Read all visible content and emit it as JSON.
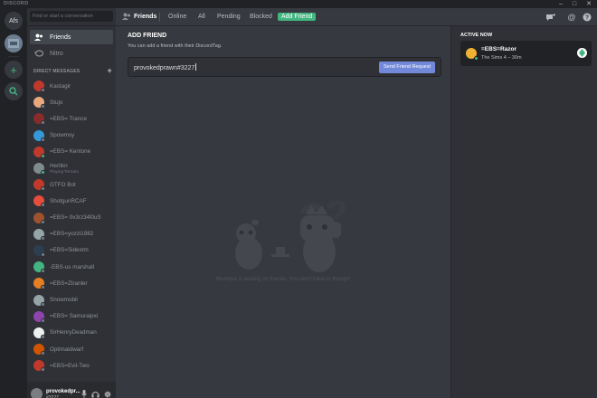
{
  "app": {
    "title": "DISCORD"
  },
  "guilds": [
    {
      "label": "Afs"
    }
  ],
  "search": {
    "placeholder": "Find or start a conversation"
  },
  "nav": {
    "friends_label": "Friends",
    "nitro_label": "Nitro"
  },
  "dm_section": {
    "header": "DIRECT MESSAGES",
    "add_symbol": "+"
  },
  "direct_messages": [
    {
      "name": "Kastagir",
      "color": "#c0392b",
      "online": false
    },
    {
      "name": "Stujo",
      "color": "#e8a87c",
      "online": false
    },
    {
      "name": "=EBS= Trance",
      "color": "#8a2b2b",
      "online": false
    },
    {
      "name": "Spowmsy",
      "color": "#3498db",
      "online": false
    },
    {
      "name": "=EBS= Kentone",
      "color": "#c0392b",
      "online": true
    },
    {
      "name": "Herlikn",
      "subtitle": "Playing Terraria",
      "color": "#7f8c8d",
      "online": true
    },
    {
      "name": "GTFO Bot",
      "color": "#c0392b",
      "online": false
    },
    {
      "name": "ShotgunRCAF",
      "color": "#e74c3c",
      "online": false
    },
    {
      "name": "=EBS= 0v3rz34l0uS",
      "color": "#a0522d",
      "online": false
    },
    {
      "name": "=EBS=yozzi1982",
      "color": "#95a5a6",
      "online": false
    },
    {
      "name": "=EBS=Sidextm",
      "color": "#2c3e50",
      "online": false
    },
    {
      "name": "-EBS-us marshall",
      "color": "#43b581",
      "online": false
    },
    {
      "name": "=EBS=Ztranler",
      "color": "#e67e22",
      "online": false
    },
    {
      "name": "Snowmobil",
      "color": "#95a5a6",
      "online": false
    },
    {
      "name": "=EBS= Samuraipxi",
      "color": "#8e44ad",
      "online": false
    },
    {
      "name": "SirHenryDeadman",
      "color": "#ecf0f1",
      "online": false
    },
    {
      "name": "Optimaldwarf",
      "color": "#d35400",
      "online": false
    },
    {
      "name": "=EBS=Evil-Two",
      "color": "#c0392b",
      "online": false
    }
  ],
  "user": {
    "name": "provokedpr...",
    "tag": "#3227"
  },
  "topbar": {
    "title": "Friends",
    "tabs": [
      "Online",
      "All",
      "Pending",
      "Blocked"
    ],
    "add_friend": "Add Friend"
  },
  "add_friend": {
    "title": "ADD FRIEND",
    "description": "You can add a friend with their DiscordTag.",
    "input_value": "provokedprawn#3227",
    "button": "Send Friend Request"
  },
  "empty_state": {
    "text": "Wumpus is waiting on friends. You don't have to though!"
  },
  "active_now": {
    "title": "ACTIVE NOW",
    "items": [
      {
        "name": "=EBS=Razor",
        "activity": "The Sims 4 – 30m"
      }
    ]
  },
  "colors": {
    "accent": "#7289da",
    "online": "#43b581",
    "background": "#36393f",
    "sidebar": "#2f3136",
    "guild_bar": "#202225"
  }
}
